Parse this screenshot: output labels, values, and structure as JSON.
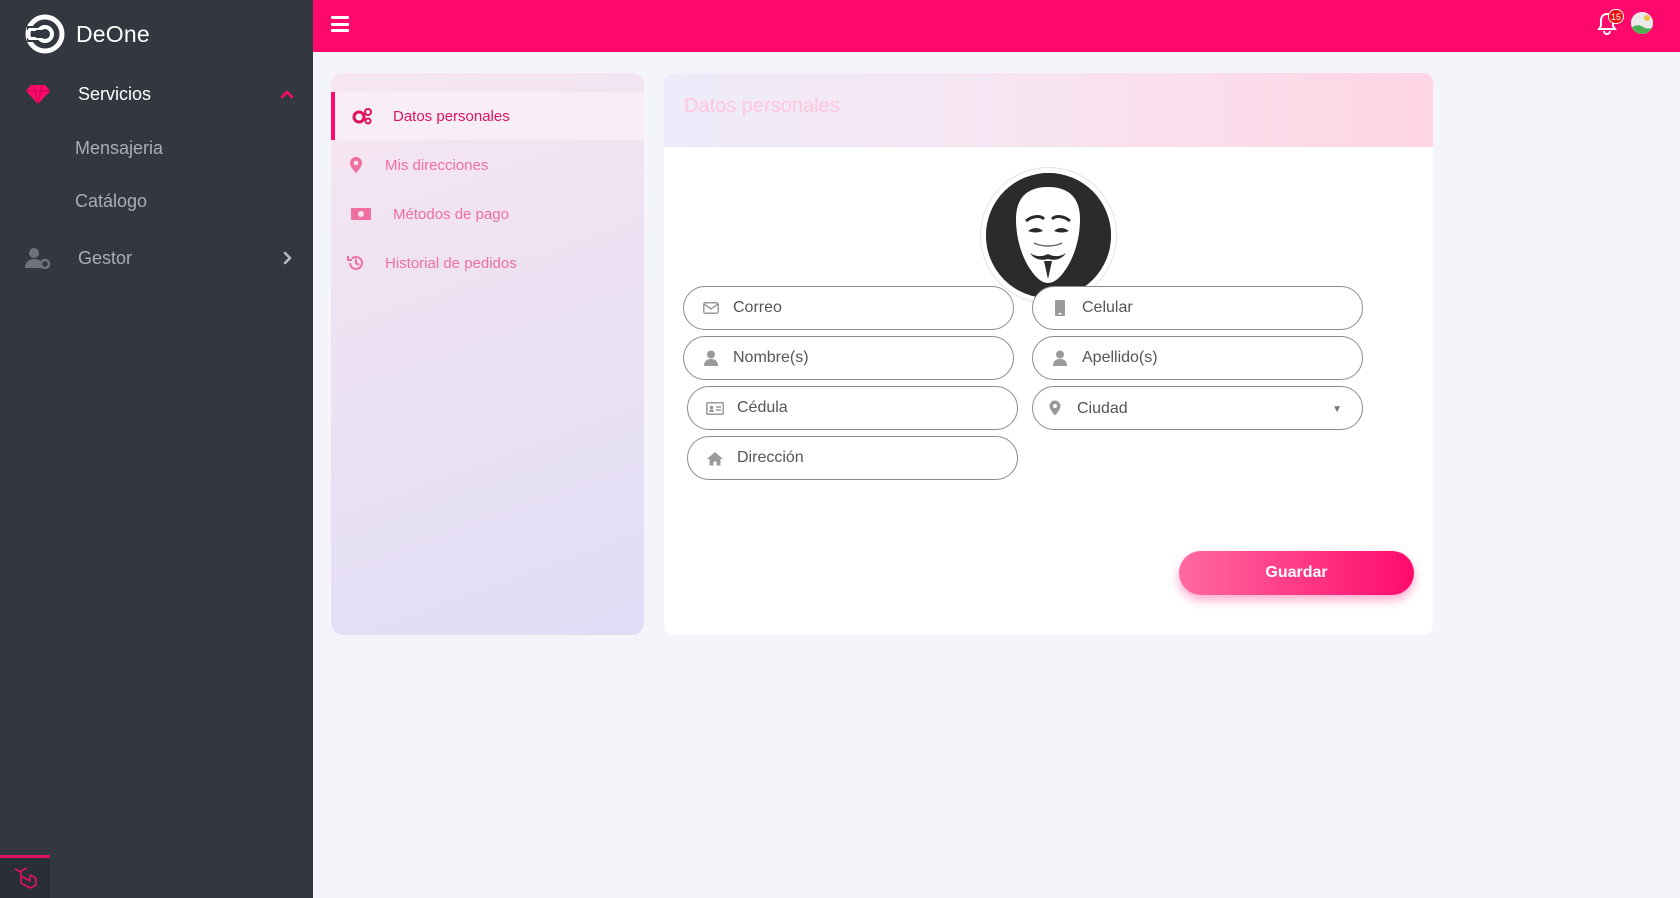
{
  "app": {
    "name": "DeOne"
  },
  "sidebar": {
    "servicios": {
      "label": "Servicios",
      "color": "#ffffff",
      "icon": "gem-icon"
    },
    "sub_items": [
      {
        "label": "Mensajeria"
      },
      {
        "label": "Catálogo"
      }
    ],
    "gestor": {
      "label": "Gestor",
      "icon": "user-gear-icon"
    }
  },
  "topbar": {
    "notifications_count": "15",
    "accent": "#ff0a6c"
  },
  "profile_menu": {
    "items": [
      {
        "label": "Datos personales",
        "icon": "gears-icon",
        "active": true
      },
      {
        "label": "Mis direcciones",
        "icon": "map-pin-icon"
      },
      {
        "label": "Métodos de pago",
        "icon": "money-icon"
      },
      {
        "label": "Historial de pedidos",
        "icon": "history-icon"
      }
    ]
  },
  "form": {
    "title": "Datos personales",
    "fields": {
      "correo": {
        "placeholder": "Correo",
        "icon": "envelope-icon"
      },
      "celular": {
        "placeholder": "Celular",
        "icon": "mobile-icon"
      },
      "nombre": {
        "placeholder": "Nombre(s)",
        "icon": "user-icon"
      },
      "apellido": {
        "placeholder": "Apellido(s)",
        "icon": "user-icon"
      },
      "cedula": {
        "placeholder": "Cédula",
        "icon": "id-card-icon"
      },
      "ciudad": {
        "selected": "Ciudad",
        "icon": "map-marker-icon"
      },
      "direccion": {
        "placeholder": "Dirección",
        "icon": "home-icon"
      }
    },
    "save_label": "Guardar"
  }
}
